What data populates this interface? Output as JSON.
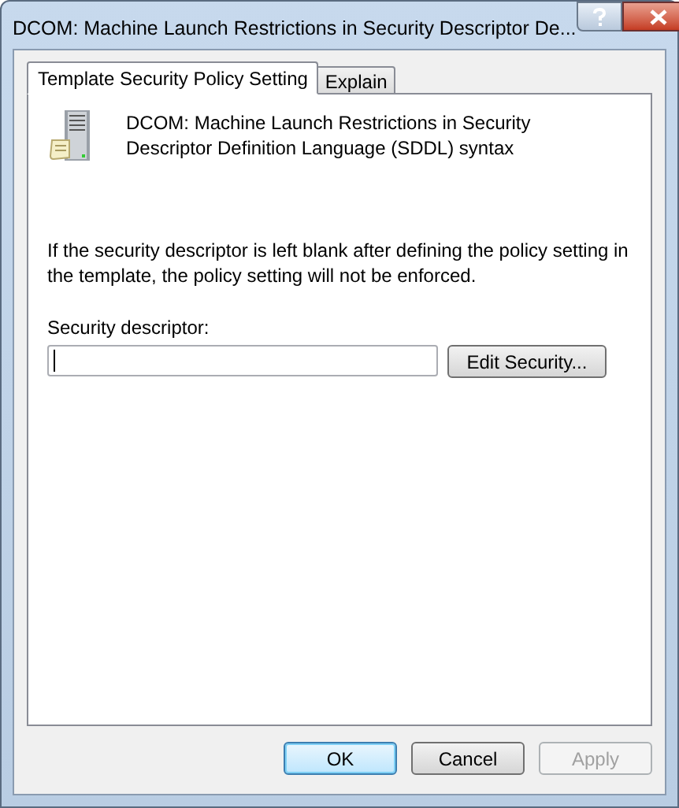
{
  "window": {
    "title": "DCOM: Machine Launch Restrictions in Security Descriptor De..."
  },
  "tabs": [
    {
      "label": "Template Security Policy Setting",
      "selected": true
    },
    {
      "label": "Explain",
      "selected": false
    }
  ],
  "policy_title": "DCOM: Machine Launch Restrictions in Security Descriptor Definition Language (SDDL) syntax",
  "note": "If the security descriptor is left blank after defining the policy setting in the template, the policy setting will not be enforced.",
  "security_descriptor": {
    "label": "Security descriptor:",
    "button": "Edit Security..."
  },
  "buttons": [
    {
      "label": "OK",
      "default": true,
      "disabled": false
    },
    {
      "label": "Cancel",
      "default": false,
      "disabled": false
    },
    {
      "label": "Apply",
      "default": false,
      "disabled": true
    }
  ]
}
